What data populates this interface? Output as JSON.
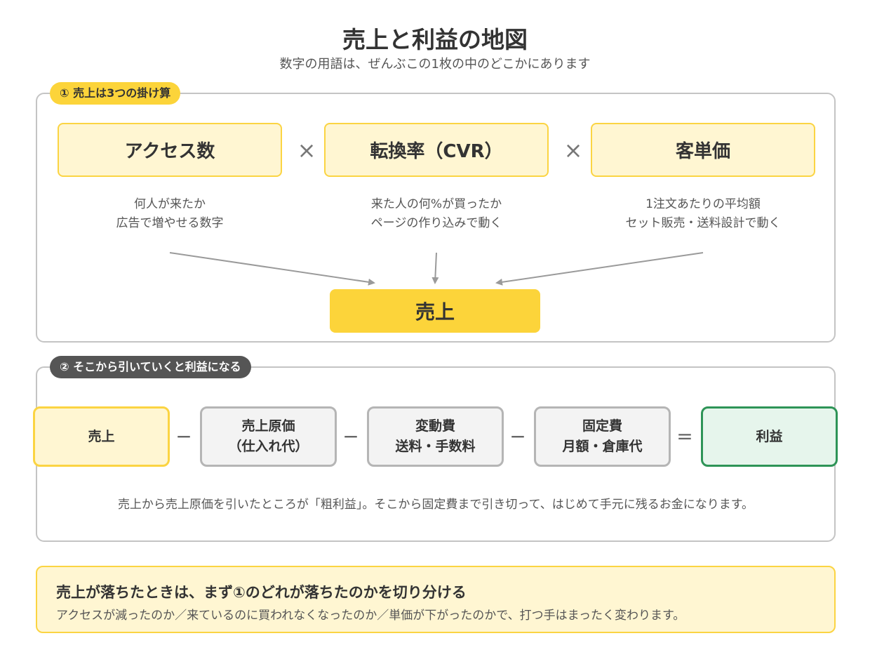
{
  "header": {
    "title": "売上と利益の地図",
    "subtitle": "数字の用語は、ぜんぶこの1枚の中のどこかにあります"
  },
  "section1": {
    "badge": "① 売上は3つの掛け算",
    "factors": [
      {
        "label": "アクセス数",
        "desc1": "何人が来たか",
        "desc2": "広告で増やせる数字"
      },
      {
        "label": "転換率（CVR）",
        "desc1": "来た人の何%が買ったか",
        "desc2": "ページの作り込みで動く"
      },
      {
        "label": "客単価",
        "desc1": "1注文あたりの平均額",
        "desc2": "セット販売・送料設計で動く"
      }
    ],
    "operator": "×",
    "result": "売上"
  },
  "section2": {
    "badge": "② そこから引いていくと利益になる",
    "terms": [
      {
        "line1": "売上"
      },
      {
        "line1": "売上原価",
        "line2": "（仕入れ代）"
      },
      {
        "line1": "変動費",
        "line2": "送料・手数料"
      },
      {
        "line1": "固定費",
        "line2": "月額・倉庫代"
      },
      {
        "line1": "利益"
      }
    ],
    "minus": "−",
    "equals": "=",
    "note": "売上から売上原価を引いたところが「粗利益」。そこから固定費まで引き切って、はじめて手元に残るお金になります。"
  },
  "callout": {
    "title": "売上が落ちたときは、まず①のどれが落ちたのかを切り分ける",
    "text": "アクセスが減ったのか／来ているのに買われなくなったのか／単価が下がったのかで、打つ手はまったく変わります。"
  },
  "colors": {
    "accent_yellow": "#fcd43a",
    "light_yellow": "#fff6d2",
    "profit_green": "#2e9457",
    "profit_bg": "#e6f5ec",
    "neutral_gray": "#b5b5b5"
  }
}
